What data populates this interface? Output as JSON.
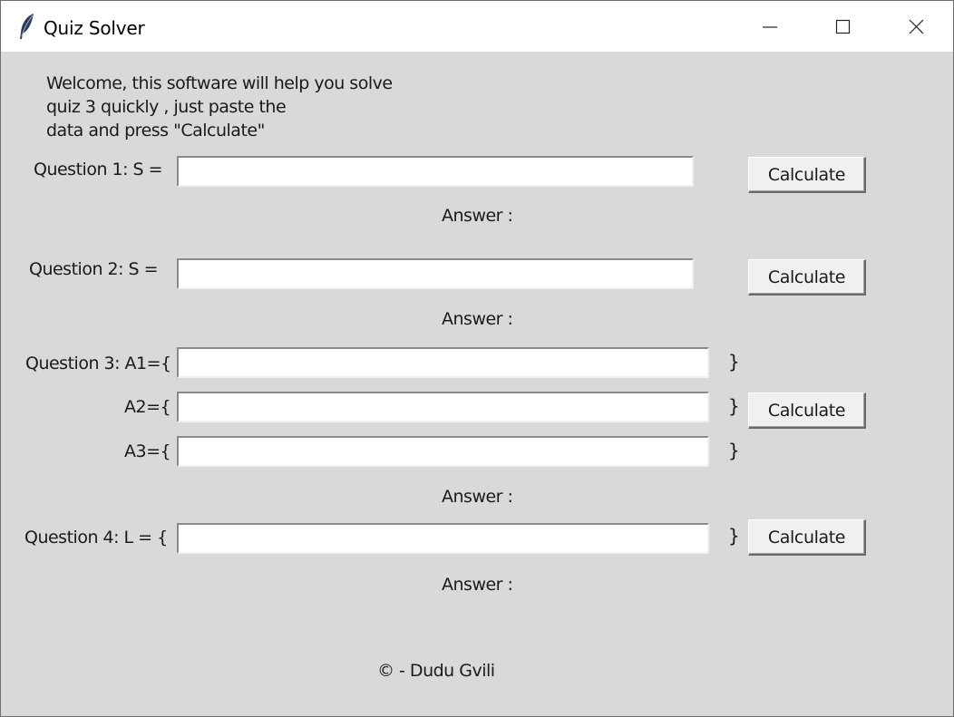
{
  "window": {
    "title": "Quiz Solver",
    "icon": "feather-icon",
    "controls": [
      "minimize-icon",
      "maximize-icon",
      "close-icon"
    ]
  },
  "welcome_lines": [
    "Welcome, this software will help you solve",
    "quiz 3 quickly , just paste the",
    "data and press \"Calculate\""
  ],
  "q1": {
    "label": "Question 1: S =",
    "value": "",
    "button": "Calculate",
    "answer": "Answer :"
  },
  "q2": {
    "label": "Question 2: S =",
    "value": "",
    "button": "Calculate",
    "answer": "Answer :"
  },
  "q3": {
    "label": "Question 3: A1={",
    "a2_label": "A2={",
    "a3_label": "A3={",
    "a1_value": "",
    "a2_value": "",
    "a3_value": "",
    "close_brace": "}",
    "button": "Calculate",
    "answer": "Answer :"
  },
  "q4": {
    "label": "Question 4: L = {",
    "value": "",
    "close_brace": "}",
    "button": "Calculate",
    "answer": "Answer :"
  },
  "footer": "© - Dudu Gvili"
}
